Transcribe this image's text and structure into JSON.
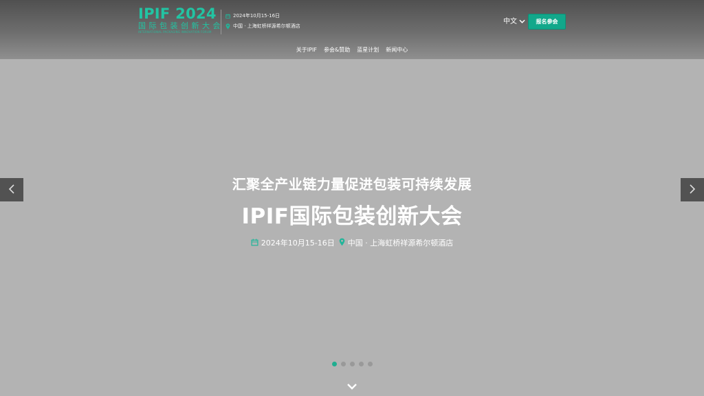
{
  "header": {
    "logo": {
      "title": "IPIF 2024",
      "subtitle_cn": "国际包装创新大会",
      "subtitle_en": "INTERNATIONAL PACKAGING INNOVATION FORUM"
    },
    "date": "2024年10月15-16日",
    "location": "中国 · 上海虹桥祥源希尔顿酒店",
    "language": "中文",
    "register_label": "报名参会"
  },
  "nav": {
    "items": [
      "关于IPIF",
      "参会&赞助",
      "蓝星计划",
      "新闻中心"
    ]
  },
  "hero": {
    "subtitle": "汇聚全产业链力量促进包装可持续发展",
    "title": "IPIF国际包装创新大会",
    "date": "2024年10月15-16日",
    "location": "中国 · 上海虹桥祥源希尔顿酒店"
  },
  "carousel": {
    "slide_count": 5,
    "active_index": 0
  },
  "icons": {
    "calendar": "calendar-icon",
    "location": "map-pin-icon",
    "prev": "chevron-left-icon",
    "next": "chevron-right-icon",
    "lang": "chevron-down-icon",
    "scroll": "chevron-down-icon"
  },
  "colors": {
    "accent": "#22c4a3",
    "button": "#12a88b",
    "arrow_bg": "#525252",
    "hero_bg": "#b3b3b3"
  }
}
